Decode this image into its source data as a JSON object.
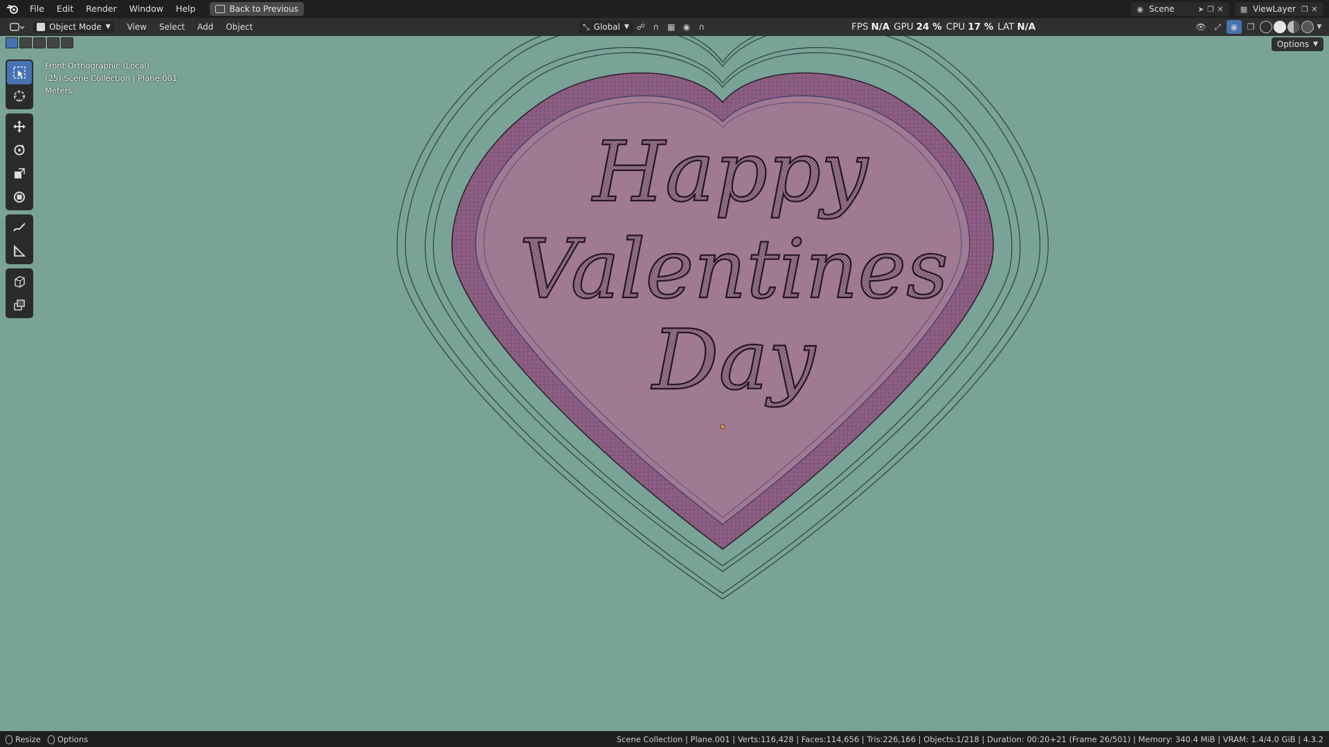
{
  "topbar": {
    "menus": [
      "File",
      "Edit",
      "Render",
      "Window",
      "Help"
    ],
    "back_button": "Back to Previous",
    "scene_name": "Scene",
    "view_layer": "ViewLayer"
  },
  "header": {
    "mode": "Object Mode",
    "menus": [
      "View",
      "Select",
      "Add",
      "Object"
    ],
    "orientation": "Global",
    "stats": {
      "fps_label": "FPS",
      "fps_value": "N/A",
      "gpu_label": "GPU",
      "gpu_value": "24 %",
      "cpu_label": "CPU",
      "cpu_value": "17 %",
      "lat_label": "LAT",
      "lat_value": "N/A"
    },
    "options_label": "Options"
  },
  "overlay": {
    "view_name": "Front Orthographic (Local)",
    "collection": "(25) Scene Collection | Plane.001",
    "units": "Meters"
  },
  "toolbar": {
    "tools": [
      "select-box",
      "cursor",
      "move",
      "rotate",
      "scale",
      "transform",
      "annotate",
      "measure",
      "add-cube",
      "extrude"
    ]
  },
  "artwork": {
    "line1": "Happy",
    "line2": "Valentines",
    "line3": "Day"
  },
  "colors": {
    "viewport_bg": "#7aa397",
    "heart_fill": "#a07a92",
    "heart_rim": "#8d5f84",
    "active_tool": "#4772b3"
  },
  "statusbar": {
    "left": [
      "Resize",
      "Options"
    ],
    "info": "Scene Collection | Plane.001 | Verts:116,428 | Faces:114,656 | Tris:226,166 | Objects:1/218 | Duration: 00:20+21 (Frame 26/501) | Memory: 340.4 MiB | VRAM: 1.4/4.0 GiB | 4.3.2"
  }
}
